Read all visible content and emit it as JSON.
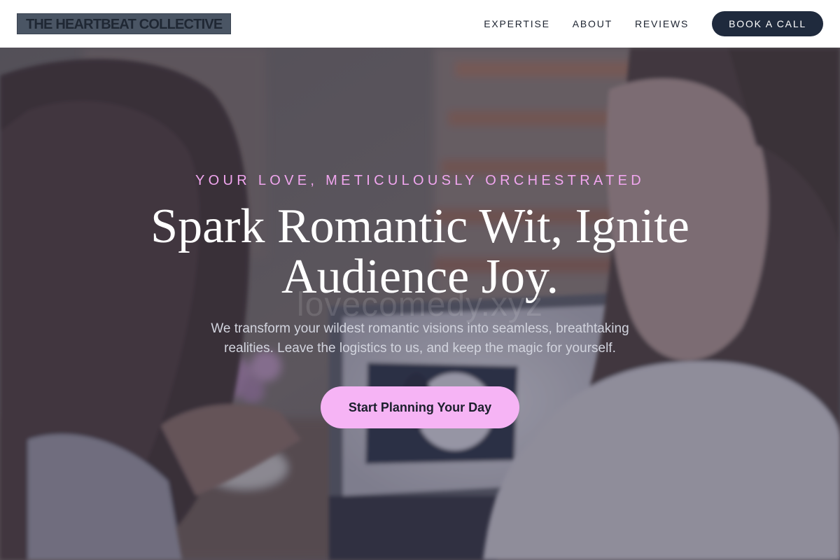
{
  "header": {
    "logo_text": "THE HEARTBEAT COLLECTIVE",
    "nav": [
      {
        "label": "EXPERTISE"
      },
      {
        "label": "ABOUT"
      },
      {
        "label": "REVIEWS"
      }
    ],
    "cta_label": "BOOK A CALL"
  },
  "hero": {
    "eyebrow": "YOUR LOVE, METICULOUSLY ORCHESTRATED",
    "headline_line1": "Spark Romantic Wit, Ignite",
    "headline_line2": "Audience Joy.",
    "subtext_line1": "We transform your wildest romantic visions into seamless, breathtaking",
    "subtext_line2": "realities. Leave the logistics to us, and keep the magic for yourself.",
    "cta_label": "Start Planning Your Day",
    "watermark": "lovecomedy.xyz"
  },
  "colors": {
    "nav_cta_bg": "#1f2a3d",
    "eyebrow": "#f1a6ef",
    "hero_cta_bg": "#f6b4f5",
    "logo_bg": "#4a5564"
  }
}
